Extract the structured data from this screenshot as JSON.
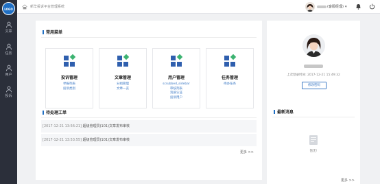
{
  "sidebar": {
    "logo_text": "LOGO",
    "items": [
      {
        "label": "文章",
        "icon": "user-icon"
      },
      {
        "label": "任务",
        "icon": "user-icon"
      },
      {
        "label": "用户",
        "icon": "user-icon"
      },
      {
        "label": "投诉",
        "icon": "user-icon"
      }
    ]
  },
  "topbar": {
    "title": "新华投诉平台管理系统",
    "user_role": "(客服经理)",
    "caret": "▾"
  },
  "quick_menu": {
    "title": "常用菜单",
    "cards": [
      {
        "title": "投诉管理",
        "links": [
          "举报列表",
          "投诉类别"
        ]
      },
      {
        "title": "文章管理",
        "links": [
          "分组管理",
          "文章一览"
        ]
      },
      {
        "title": "用户管理",
        "links": [
          "scrubbed_sidebar",
          "审核列表",
          "资质认证",
          "投诉用户"
        ]
      },
      {
        "title": "任务管理",
        "links": [
          "待办任务"
        ]
      }
    ]
  },
  "tasks": {
    "title": "待处理工单",
    "rows": [
      {
        "time": "[2017-12-21 13:56:21]",
        "text": "超级管理员(101)文章发布审核"
      },
      {
        "time": "[2017-12-21 13:53:55]",
        "text": "超级管理员(101)文章发布审核"
      }
    ],
    "more": "更多 >>"
  },
  "profile": {
    "last_login": "上次登录时间: 2017-12-21 15:49:32",
    "change_password": "修改密码"
  },
  "messages": {
    "title": "最新消息",
    "empty": "暂无!",
    "more": "更多 >>"
  },
  "colors": {
    "sidebar_bg": "#2b2f3a",
    "accent": "#1f6fc4",
    "link": "#3b78c4"
  }
}
